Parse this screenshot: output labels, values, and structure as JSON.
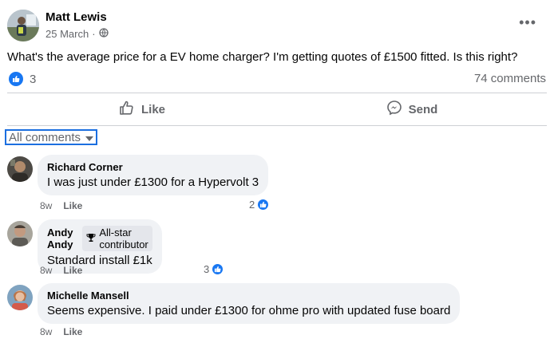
{
  "post": {
    "author": "Matt Lewis",
    "date": "25 March",
    "date_separator": "·",
    "audience_icon": "globe-icon",
    "more_icon": "more-horizontal-icon",
    "more_glyph": "•••",
    "text": "What's the average price for a EV home charger? I'm getting quotes of £1500 fitted. Is this right?",
    "reaction_count": "3",
    "comment_count": "74 comments"
  },
  "actions": {
    "like_label": "Like",
    "send_label": "Send"
  },
  "filter": {
    "label": "All comments"
  },
  "comments": [
    {
      "name": "Richard Corner",
      "text": "I was just under £1300 for a Hypervolt 3",
      "time": "8w",
      "like_label": "Like",
      "reactions": "2"
    },
    {
      "name": "Andy Andy",
      "badge": "All-star contributor",
      "text": "Standard install £1k",
      "time": "8w",
      "like_label": "Like",
      "reactions": "3"
    },
    {
      "name": "Michelle Mansell",
      "text": "Seems expensive. I paid under £1300 for ohme pro with updated fuse board",
      "time": "8w",
      "like_label": "Like"
    }
  ],
  "colors": {
    "accent": "#1877f2",
    "secondary_text": "#65676b",
    "bubble": "#f0f2f5"
  }
}
